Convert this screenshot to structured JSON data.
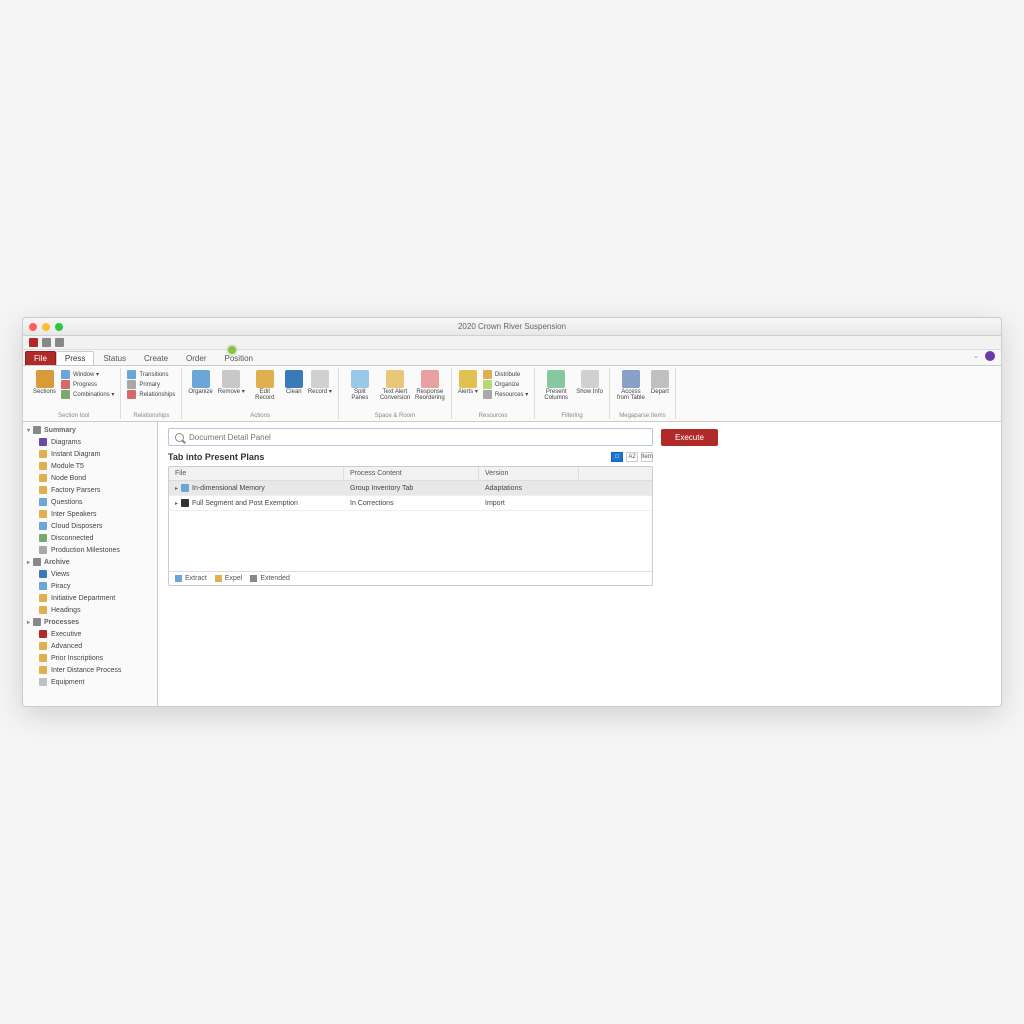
{
  "window": {
    "title": "2020 Crown River Suspension"
  },
  "tabs": {
    "file": "File",
    "items": [
      "Press",
      "Status",
      "Create",
      "Order",
      "Position"
    ],
    "active_index": 0
  },
  "ribbon": {
    "groups": [
      {
        "title": "Section tool",
        "big": [
          {
            "label": "Sections",
            "color": "#d99a3a"
          }
        ],
        "small": [
          {
            "label": "Window ▾",
            "color": "#6aa6d8"
          },
          {
            "label": "Progress",
            "color": "#d46a6a"
          },
          {
            "label": "Combinations ▾",
            "color": "#7aa86a"
          }
        ]
      },
      {
        "title": "Relationships",
        "big": [],
        "small": [
          {
            "label": "Transitions",
            "color": "#6aa6d8"
          },
          {
            "label": "Primary",
            "color": "#a8a8a8"
          },
          {
            "label": "Relationships",
            "color": "#d46a6a"
          }
        ]
      },
      {
        "title": "Actions",
        "big": [
          {
            "label": "Organize",
            "color": "#6aa6d8"
          },
          {
            "label": "Remove ▾",
            "color": "#c8c8c8"
          },
          {
            "label": "Edit Record",
            "color": "#e0b050"
          },
          {
            "label": "Clean",
            "color": "#3a7ab8"
          },
          {
            "label": "Record ▾",
            "color": "#d0d0d0"
          }
        ],
        "small": []
      },
      {
        "title": "Space & Room",
        "big": [
          {
            "label": "Split Panes",
            "color": "#9ac8e8"
          },
          {
            "label": "Text Alert Conversion",
            "color": "#e8c878"
          },
          {
            "label": "Response Reordering",
            "color": "#e8a0a0"
          }
        ],
        "small": []
      },
      {
        "title": "Resources",
        "big": [
          {
            "label": "Alerts ▾",
            "color": "#e0c050"
          }
        ],
        "small": [
          {
            "label": "Distribute",
            "color": "#e0b050"
          },
          {
            "label": "Organize",
            "color": "#b8d878"
          },
          {
            "label": "Resources ▾",
            "color": "#a8a8a8"
          }
        ]
      },
      {
        "title": "Filtering",
        "big": [
          {
            "label": "Present Columns",
            "color": "#88c8a0"
          },
          {
            "label": "Show Info",
            "color": "#d0d0d0"
          }
        ],
        "small": []
      },
      {
        "title": "Megaparse Items",
        "big": [
          {
            "label": "Access from Table",
            "color": "#88a0c8"
          },
          {
            "label": "Depart",
            "color": "#c0c0c0"
          }
        ],
        "small": []
      }
    ]
  },
  "sidebar": {
    "sections": [
      {
        "label": "Summary",
        "open": true,
        "items": [
          {
            "label": "Diagrams",
            "color": "#6a4aa8"
          },
          {
            "label": "Instant Diagram",
            "color": "#e0b050"
          },
          {
            "label": "Module T5",
            "color": "#e0b050"
          },
          {
            "label": "Node Bond",
            "color": "#e0b050"
          },
          {
            "label": "Factory Parsers",
            "color": "#e0b050"
          },
          {
            "label": "Questions",
            "color": "#6aa6d8"
          },
          {
            "label": "Inter Speakers",
            "color": "#e0b050"
          },
          {
            "label": "Cloud Disposers",
            "color": "#6aa6d8"
          },
          {
            "label": "Disconnected",
            "color": "#7aa86a"
          },
          {
            "label": "Production Milestones",
            "color": "#a8a8a8"
          }
        ]
      },
      {
        "label": "Archive",
        "open": false,
        "items": [
          {
            "label": "Views",
            "color": "#3a7ab8"
          },
          {
            "label": "Piracy",
            "color": "#6aa6d8"
          },
          {
            "label": "Initiative Department",
            "color": "#e0b050"
          },
          {
            "label": "Headings",
            "color": "#e0b050"
          }
        ]
      },
      {
        "label": "Processes",
        "open": false,
        "items": [
          {
            "label": "Executive",
            "color": "#b02a2a"
          },
          {
            "label": "Advanced",
            "color": "#e0b050"
          },
          {
            "label": "Prior Inscriptions",
            "color": "#e0b050"
          },
          {
            "label": "Inter Distance Process",
            "color": "#e0b050"
          },
          {
            "label": "Equipment",
            "color": "#c0c0c0"
          }
        ]
      }
    ]
  },
  "search": {
    "placeholder": "Document Detail Panel"
  },
  "primary_action": "Execute",
  "panel": {
    "title": "Tab into Present Plans",
    "tools": [
      "□",
      "A2",
      "Item"
    ],
    "columns": [
      "File",
      "Process Content",
      "Version"
    ],
    "rows": [
      {
        "expandable": true,
        "icon": "#6aa6d8",
        "file": "In-dimensional Memory",
        "content": "Group Inventory Tab",
        "version": "Adaptations",
        "selected": true
      },
      {
        "expandable": true,
        "icon": "#333",
        "file": "Full Segment and Post Exemption",
        "content": "In Corrections",
        "version": "Import",
        "selected": false
      }
    ],
    "footer": [
      {
        "label": "Extract",
        "color": "#6aa6d8"
      },
      {
        "label": "Expel",
        "color": "#e0b050"
      },
      {
        "label": "Extended",
        "color": "#888"
      }
    ]
  }
}
